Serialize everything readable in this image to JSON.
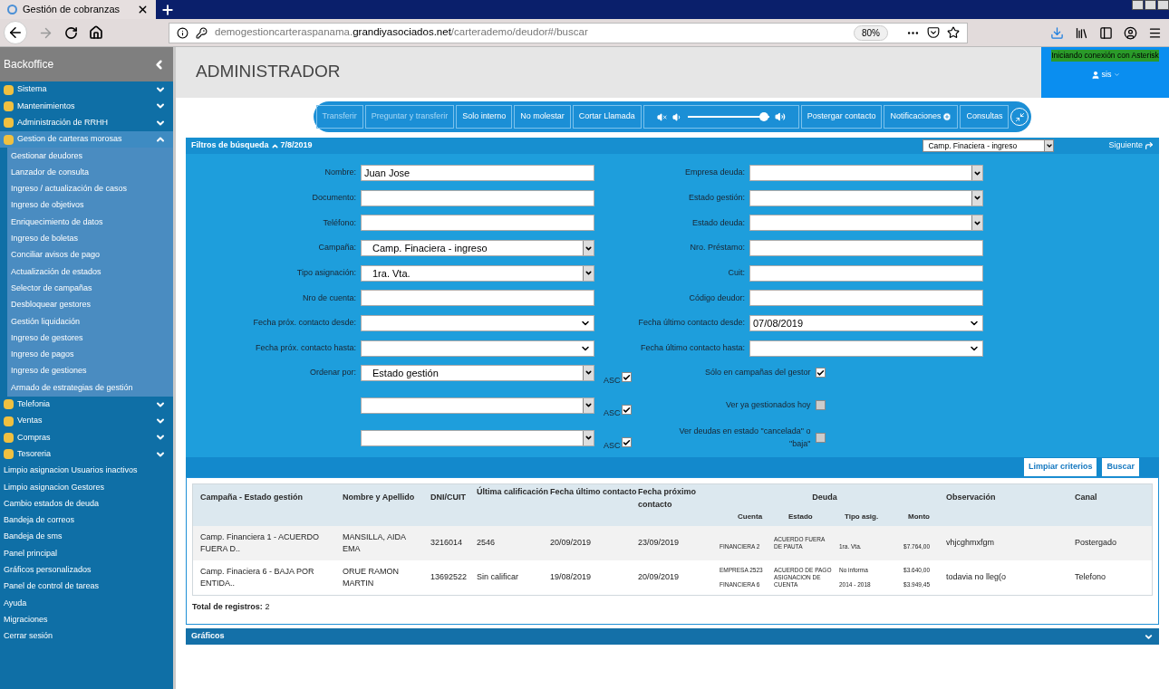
{
  "browser": {
    "tab_title": "Gestión de cobranzas",
    "url_host_prefix": "demogestioncarteraspanama.",
    "url_host": "grandiyasociados.net",
    "url_path": "/carterademo/deudor#/buscar",
    "zoom": "80%"
  },
  "sidebar": {
    "title": "Backoffice",
    "items": [
      {
        "kind": "group",
        "label": "Sistema",
        "expanded": false
      },
      {
        "kind": "group",
        "label": "Mantenimientos",
        "expanded": false
      },
      {
        "kind": "group",
        "label": "Administración de RRHH",
        "expanded": false
      },
      {
        "kind": "group",
        "label": "Gestion de carteras morosas",
        "expanded": true,
        "children": [
          {
            "label": "Gestionar deudores"
          },
          {
            "label": "Lanzador de consulta"
          },
          {
            "label": "Ingreso / actualización de casos"
          },
          {
            "label": "Ingreso de objetivos"
          },
          {
            "label": "Enriquecimiento de datos"
          },
          {
            "label": "Ingreso de boletas"
          },
          {
            "label": "Conciliar avisos de pago"
          },
          {
            "label": "Actualización de estados"
          },
          {
            "label": "Selector de campañas"
          },
          {
            "label": "Desbloquear gestores"
          },
          {
            "label": "Gestión liquidación"
          },
          {
            "label": "Ingreso de gestores"
          },
          {
            "label": "Ingreso de pagos"
          },
          {
            "label": "Ingreso de gestiones"
          },
          {
            "label": "Armado de estrategias de gestión"
          }
        ]
      },
      {
        "kind": "group",
        "label": "Telefonia",
        "expanded": false
      },
      {
        "kind": "group",
        "label": "Ventas",
        "expanded": false
      },
      {
        "kind": "group",
        "label": "Compras",
        "expanded": false
      },
      {
        "kind": "group",
        "label": "Tesoreria",
        "expanded": false
      },
      {
        "kind": "link",
        "label": "Limpio asignacion Usuarios inactivos"
      },
      {
        "kind": "link",
        "label": "Limpio asignacion Gestores"
      },
      {
        "kind": "link",
        "label": "Cambio estados de deuda"
      },
      {
        "kind": "link",
        "label": "Bandeja de correos"
      },
      {
        "kind": "link",
        "label": "Bandeja de sms"
      },
      {
        "kind": "link",
        "label": "Panel principal"
      },
      {
        "kind": "link",
        "label": "Gráficos personalizados"
      },
      {
        "kind": "link",
        "label": "Panel de control de tareas"
      },
      {
        "kind": "link",
        "label": "Ayuda"
      },
      {
        "kind": "link",
        "label": "Migraciones"
      },
      {
        "kind": "link",
        "label": "Cerrar sesión"
      }
    ]
  },
  "header": {
    "title": "ADMINISTRADOR",
    "connection_status": "Iniciando conexión con Asterisk",
    "user": "sis"
  },
  "call_toolbar": {
    "buttons_left": [
      {
        "label": "Transferir",
        "disabled": true
      },
      {
        "label": "Preguntar y transferir",
        "disabled": true
      },
      {
        "label": "Solo interno",
        "disabled": false
      },
      {
        "label": "No molestar",
        "disabled": false
      },
      {
        "label": "Cortar Llamada",
        "disabled": false
      }
    ],
    "volume": {
      "level": 0.93
    },
    "buttons_right": [
      {
        "label": "Postergar contacto",
        "kind": "plain"
      },
      {
        "label": "Notificaciones",
        "kind": "plus"
      },
      {
        "label": "Consultas",
        "kind": "plain"
      }
    ]
  },
  "filters": {
    "title": "Filtros de búsqueda",
    "date": "7/8/2019",
    "campaign_select": "Camp. Finaciera - ingreso",
    "next": "Siguiente",
    "left_fields": [
      {
        "label": "Nombre:",
        "kind": "text",
        "value": "Juan Jose"
      },
      {
        "label": "Documento:",
        "kind": "text"
      },
      {
        "label": "Teléfono:",
        "kind": "text"
      },
      {
        "label": "Campaña:",
        "kind": "select",
        "value": "Camp. Finaciera - ingreso"
      },
      {
        "label": "Tipo asignación:",
        "kind": "select",
        "value": "1ra. Vta."
      },
      {
        "label": "Nro de cuenta:",
        "kind": "text"
      },
      {
        "label": "Fecha próx. contacto desde:",
        "kind": "date"
      },
      {
        "label": "Fecha próx. contacto hasta:",
        "kind": "date"
      }
    ],
    "right_fields": [
      {
        "label": "Empresa deuda:",
        "kind": "select"
      },
      {
        "label": "Estado gestión:",
        "kind": "select"
      },
      {
        "label": "Estado deuda:",
        "kind": "select"
      },
      {
        "label": "Nro. Préstamo:",
        "kind": "text"
      },
      {
        "label": "Cuit:",
        "kind": "text"
      },
      {
        "label": "Código deudor:",
        "kind": "text"
      },
      {
        "label": "Fecha último contacto desde:",
        "kind": "date",
        "value": "07/08/2019"
      },
      {
        "label": "Fecha último contacto hasta:",
        "kind": "date"
      }
    ],
    "order_label": "Ordenar por:",
    "order_rows": [
      {
        "value": "Estado gestión",
        "asc_label": "ASC",
        "asc": true,
        "option_label": "Sólo en campañas del gestor",
        "option_checked": true
      },
      {
        "asc_label": "ASC",
        "asc": true,
        "option_label": "Ver ya gestionados hoy",
        "option_checked": false
      },
      {
        "asc_label": "ASC",
        "asc": true,
        "option_label": "Ver deudas en estado \"cancelada\" o \"baja\"",
        "option_checked": false
      }
    ],
    "buttons": [
      "Limpiar criterios",
      "Buscar"
    ]
  },
  "results": {
    "columns": [
      "Campaña - Estado gestión",
      "Nombre y Apellido",
      "DNI/CUIT",
      "Última calificación",
      "Fecha último contacto",
      "Fecha próximo contacto",
      "Deuda",
      "Observación",
      "Canal"
    ],
    "debt_columns": [
      "Cuenta",
      "Estado",
      "Tipo asig.",
      "Monto"
    ],
    "rows": [
      {
        "campaign": "Camp. Financiera 1 - ACUERDO FUERA D..",
        "name": "MANSILLA, AIDA EMA",
        "dni": "3216014",
        "rating": "2546",
        "last_contact": "20/09/2019",
        "next_contact": "23/09/2019",
        "debts": [
          {
            "account": "FINANCIERA 2",
            "state": "ACUERDO FUERA DE PAUTA",
            "type": "1ra. Vta.",
            "amount": "$7.764,00"
          }
        ],
        "observation": "vhjcghmxfgm",
        "channel": "Postergado"
      },
      {
        "campaign": "Camp. Finaciera 6 - BAJA POR ENTIDA..",
        "name": "ORUE RAMON MARTIN",
        "dni": "13692522",
        "rating": "Sin calificar",
        "last_contact": "19/08/2019",
        "next_contact": "20/09/2019",
        "debts": [
          {
            "account": "EMPRESA 2523",
            "state": "ACUERDO DE PAGO",
            "type": "No informa",
            "amount": "$3.640,00"
          },
          {
            "account": "FINANCIERA 6",
            "state": "ASIGNACION DE CUENTA",
            "type": "2014 - 2018",
            "amount": "$3.949,45"
          }
        ],
        "observation": "todavia no lleg(o",
        "channel": "Telefono"
      }
    ],
    "total_label": "Total de registros:",
    "total": "2"
  },
  "charts_section": {
    "title": "Gráficos"
  }
}
